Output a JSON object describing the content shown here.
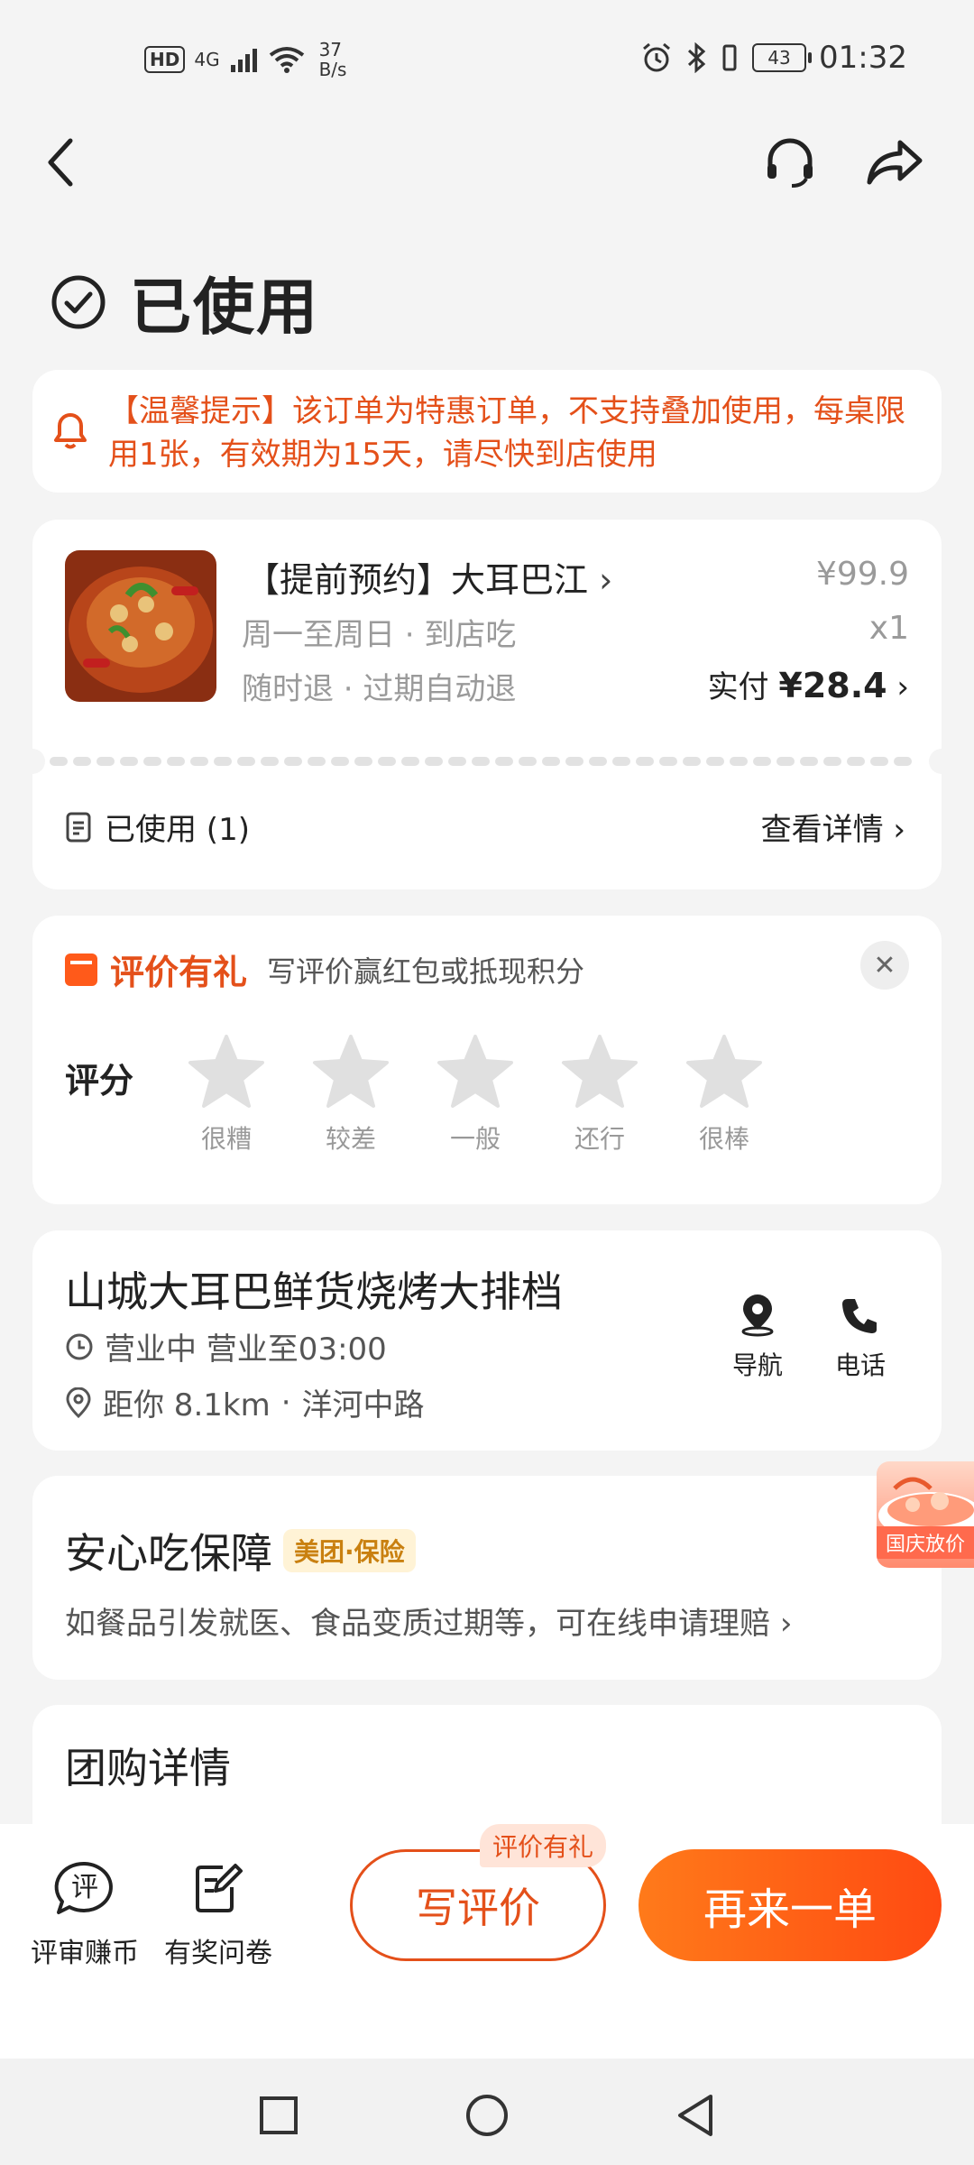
{
  "status_bar": {
    "hd": "HD",
    "network": "4G",
    "speed_value": "37",
    "speed_unit": "B/s",
    "battery": "43",
    "time": "01:32"
  },
  "header": {
    "status_title": "已使用"
  },
  "tip": {
    "text": "【温馨提示】该订单为特惠订单，不支持叠加使用，每桌限用1张，有效期为15天，请尽快到店使用"
  },
  "order": {
    "title": "【提前预约】大耳巴江",
    "line2": "周一至周日 · 到店吃",
    "line3": "随时退 · 过期自动退",
    "price": "¥99.9",
    "qty": "x1",
    "paid_label": "实付",
    "paid_amount": "¥28.4",
    "used_label": "已使用 (1)",
    "detail_link": "查看详情"
  },
  "review": {
    "title": "评价有礼",
    "subtitle": "写评价赢红包或抵现积分",
    "score_label": "评分",
    "stars": [
      "很糟",
      "较差",
      "一般",
      "还行",
      "很棒"
    ]
  },
  "store": {
    "name": "山城大耳巴鲜货烧烤大排档",
    "hours": "营业中 营业至03:00",
    "distance": "距你 8.1km",
    "road": "洋河中路",
    "nav_label": "导航",
    "call_label": "电话"
  },
  "safety": {
    "title": "安心吃保障",
    "badge": "美团·保险",
    "desc": "如餐品引发就医、食品变质过期等，可在线申请理赔"
  },
  "promo": {
    "text": "国庆放价"
  },
  "group": {
    "title": "团购详情"
  },
  "bottom": {
    "review_coin": "评审赚币",
    "survey": "有奖问卷",
    "write_review": "写评价",
    "write_tag": "评价有礼",
    "order_again": "再来一单",
    "review_icon_char": "评"
  },
  "colors": {
    "accent": "#e4501a",
    "accent_gradient_start": "#ff7a1a",
    "accent_gradient_end": "#ff4a12",
    "background": "#f4f4f4"
  }
}
